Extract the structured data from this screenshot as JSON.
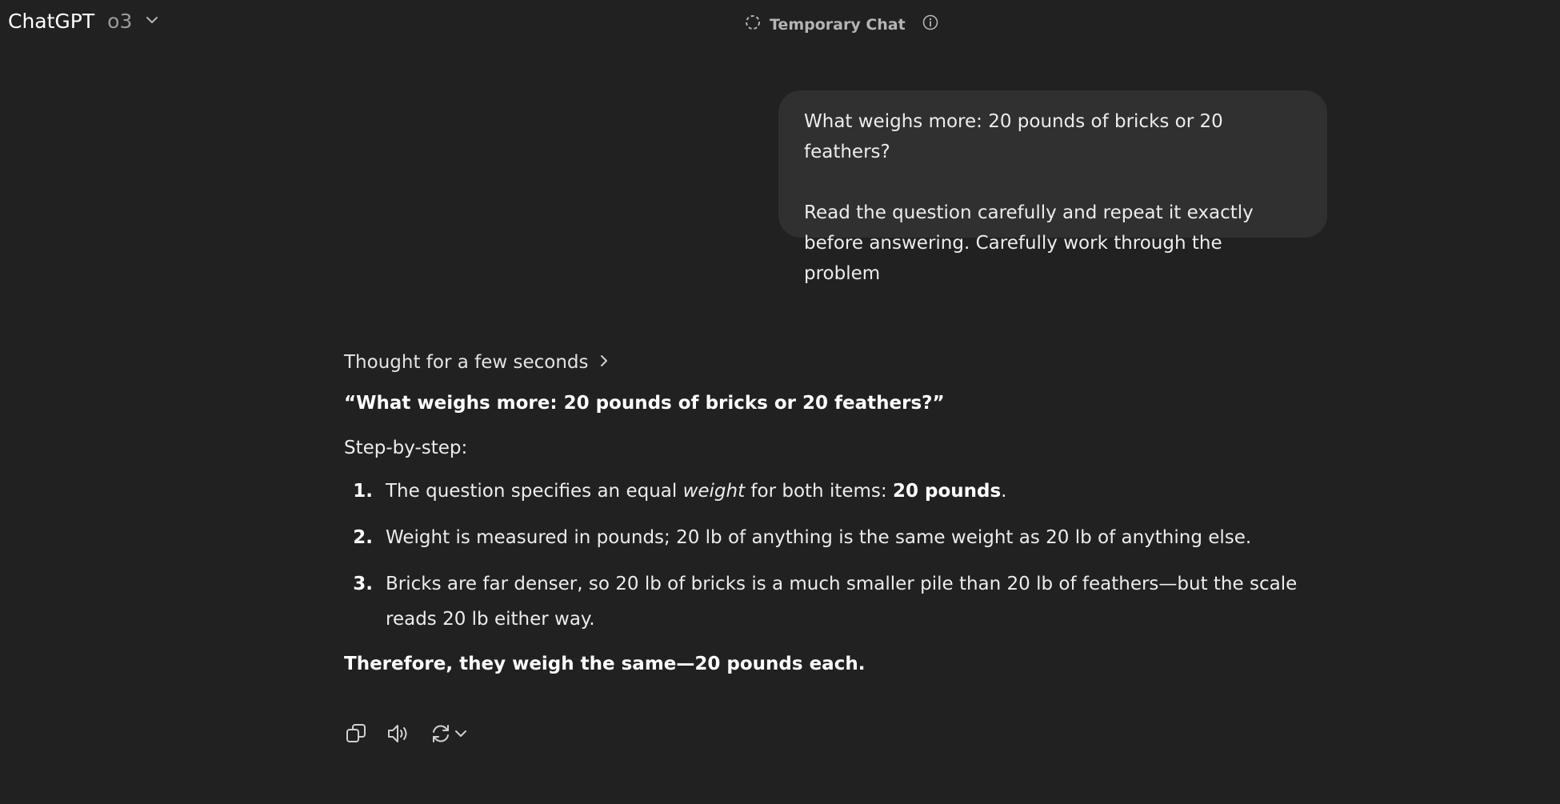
{
  "header": {
    "model_name": "ChatGPT",
    "model_version": "o3",
    "temporary_chat_label": "Temporary Chat"
  },
  "user_message": {
    "line1": "What weighs more: 20 pounds of bricks or 20 feathers?",
    "line2": "Read the question carefully and repeat it exactly before answering. Carefully work through the problem"
  },
  "assistant": {
    "thought_label": "Thought for a few seconds",
    "quote": "“What weighs more: 20 pounds of bricks or 20 feathers?”",
    "steps_heading": "Step-by-step:",
    "steps": [
      {
        "num": "1.",
        "pre": "The question specifies an equal ",
        "italic": "weight",
        "mid": " for both items: ",
        "bold": "20 pounds",
        "post": "."
      },
      {
        "num": "2.",
        "text": "Weight is measured in pounds; 20 lb of anything is the same weight as 20 lb of anything else."
      },
      {
        "num": "3.",
        "text": "Bricks are far denser, so 20 lb of bricks is a much smaller pile than 20 lb of feathers—but the scale reads 20 lb either way."
      }
    ],
    "conclusion": "Therefore, they weigh the same—20 pounds each."
  },
  "actions": {
    "icons": [
      "copy-icon",
      "speaker-icon",
      "regenerate-icon",
      "chevron-down-icon"
    ]
  },
  "colors": {
    "background": "#212121",
    "user_bubble": "#303030",
    "text": "#ececec",
    "muted": "#9b9b9b"
  }
}
